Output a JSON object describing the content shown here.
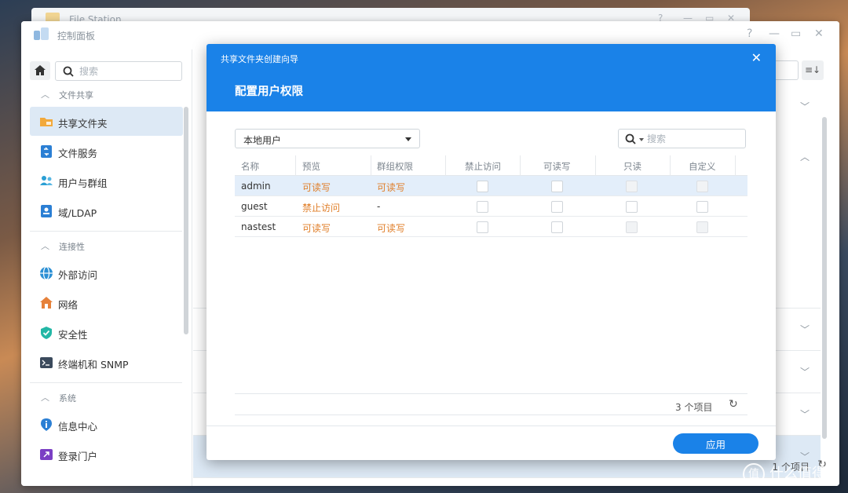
{
  "file_station": {
    "title": "File Station"
  },
  "control_panel": {
    "title": "控制面板",
    "search_placeholder": "搜索",
    "sections": [
      {
        "label": "文件共享"
      },
      {
        "label": "连接性"
      },
      {
        "label": "系统"
      }
    ],
    "items": {
      "shared_folder": "共享文件夹",
      "file_services": "文件服务",
      "users_groups": "用户与群组",
      "domain_ldap": "域/LDAP",
      "external_access": "外部访问",
      "network": "网络",
      "security": "安全性",
      "terminal_snmp": "终端机和 SNMP",
      "info_center": "信息中心",
      "login_portal": "登录门户"
    },
    "main_footer": {
      "count": "1 个项目"
    }
  },
  "wizard": {
    "title": "共享文件夹创建向导",
    "step_title": "配置用户权限",
    "user_type": "本地用户",
    "search_placeholder": "搜索",
    "columns": {
      "name": "名称",
      "preview": "预览",
      "group_perm": "群组权限",
      "no_access": "禁止访问",
      "read_write": "可读写",
      "read_only": "只读",
      "custom": "自定义"
    },
    "rows": [
      {
        "name": "admin",
        "preview": "可读写",
        "group": "可读写"
      },
      {
        "name": "guest",
        "preview": "禁止访问",
        "group": "-"
      },
      {
        "name": "nastest",
        "preview": "可读写",
        "group": "可读写"
      }
    ],
    "count": "3 个项目",
    "apply_label": "应用"
  },
  "watermark": {
    "text": "什么值得买",
    "badge": "值"
  },
  "colors": {
    "accent": "#1a82e8",
    "permission_text": "#e07f2a",
    "selected_row": "#e3eefa"
  }
}
